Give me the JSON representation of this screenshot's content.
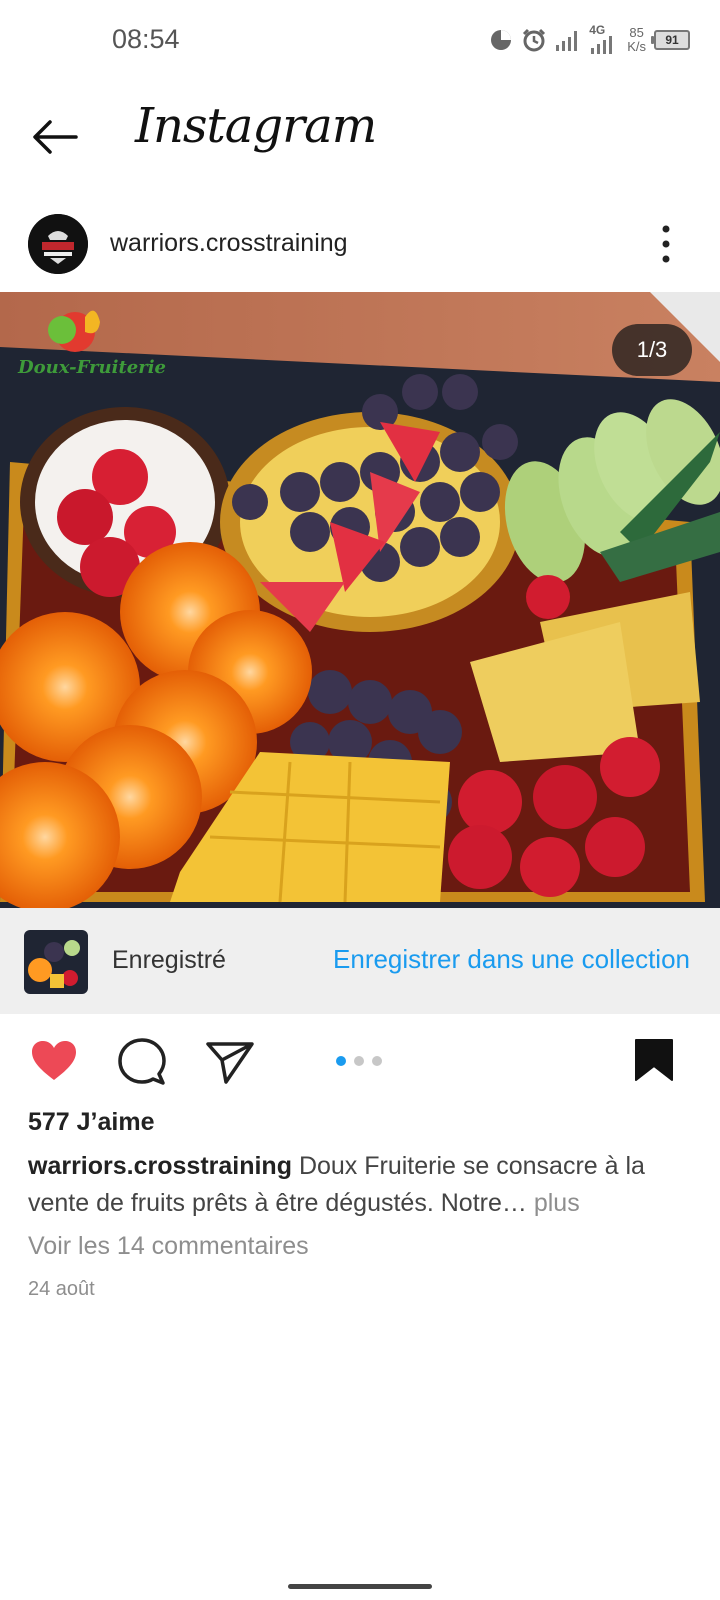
{
  "status_bar": {
    "time": "08:54",
    "network": "4G",
    "speed_value": "85",
    "speed_unit": "K/s",
    "battery": "91",
    "icons": [
      "data-saver-icon",
      "alarm-icon",
      "signal-icon",
      "signal-4g-icon",
      "battery-icon"
    ]
  },
  "header": {
    "title": "Instagram",
    "back_icon": "arrow-left-icon"
  },
  "post": {
    "username": "warriors.crosstraining",
    "more_icon": "vertical-dots-icon",
    "image": {
      "counter": "1/3",
      "brand_logo": "Doux-Fruiterie",
      "description_subject": "fruit platter"
    },
    "saved_bar": {
      "label": "Enregistré",
      "link": "Enregistrer dans une collection"
    },
    "actions": {
      "like_icon": "heart-filled-icon",
      "comment_icon": "comment-icon",
      "share_icon": "paper-plane-icon",
      "save_icon": "bookmark-filled-icon",
      "carousel_total": 3,
      "carousel_active": 1
    },
    "likes": "577 J’aime",
    "caption_user": "warriors.crosstraining",
    "caption_text": "Doux Fruiterie se consacre à la vente de fruits prêts à être dégustés. Notre…",
    "caption_more": "plus",
    "comments_link": "Voir les 14 commentaires",
    "date": "24 août"
  },
  "colors": {
    "link_blue": "#1a9bef",
    "like_red": "#ed4956",
    "saved_bar_bg": "#efefef"
  }
}
